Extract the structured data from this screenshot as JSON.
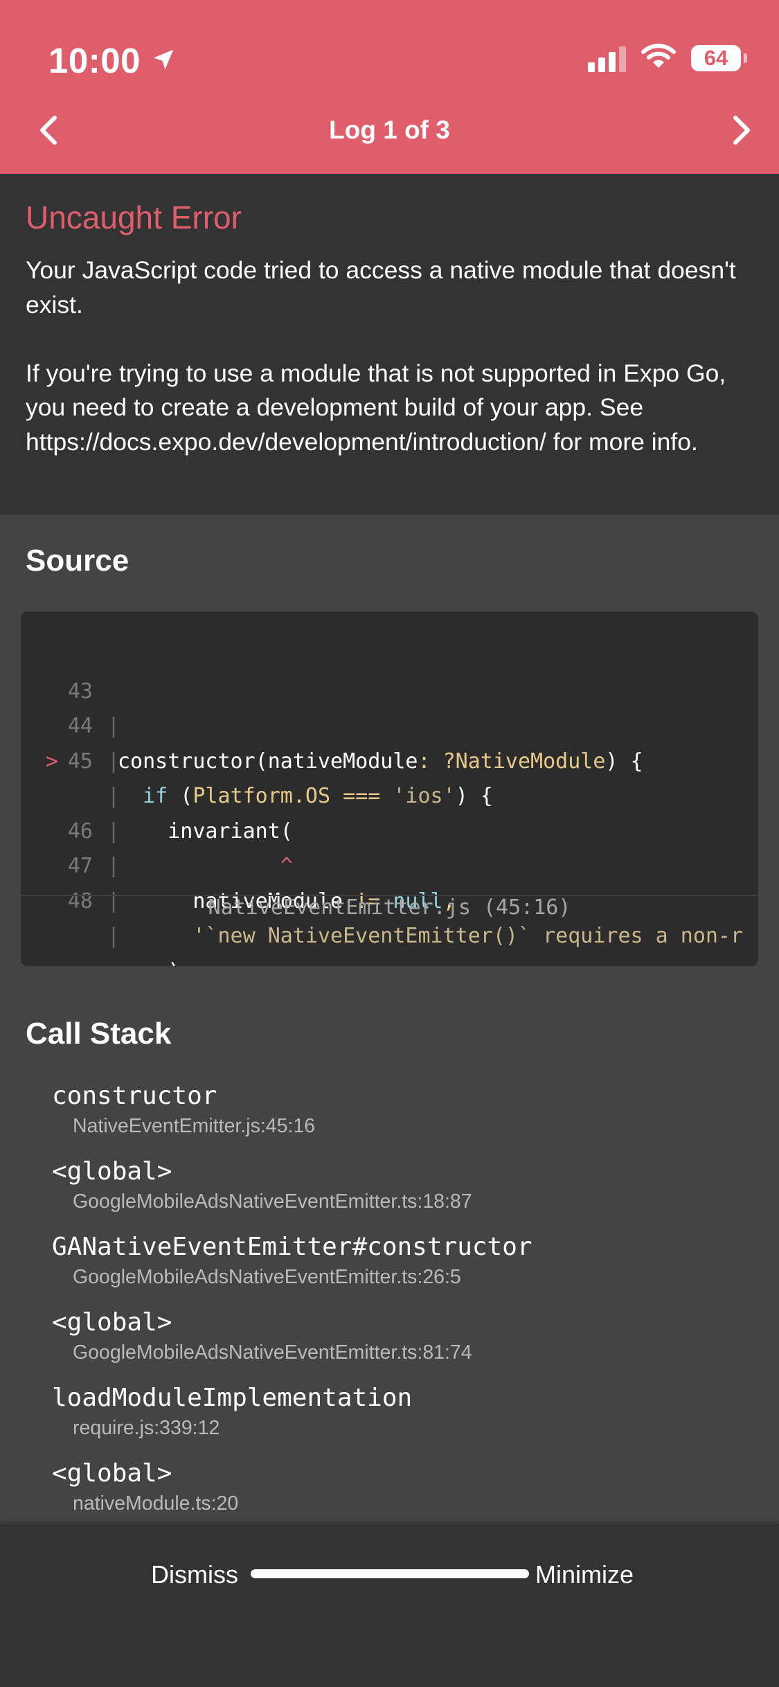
{
  "status_bar": {
    "time": "10:00",
    "battery": "64"
  },
  "nav": {
    "title": "Log 1 of 3"
  },
  "error": {
    "title": "Uncaught Error",
    "message": "Your JavaScript code tried to access a native module that doesn't exist.\n\nIf you're trying to use a module that is not supported in Expo Go, you need to create a development build of your app. See https://docs.expo.dev/development/introduction/ for more info."
  },
  "source": {
    "heading": "Source",
    "lines": [
      {
        "num": "43",
        "mark": ""
      },
      {
        "num": "44",
        "mark": ""
      },
      {
        "num": "45",
        "mark": ">"
      },
      {
        "num": "",
        "mark": ""
      },
      {
        "num": "46",
        "mark": ""
      },
      {
        "num": "47",
        "mark": ""
      },
      {
        "num": "48",
        "mark": ""
      }
    ],
    "file": "NativeEventEmitter.js (45:16)"
  },
  "call_stack": {
    "heading": "Call Stack",
    "frames": [
      {
        "name": "constructor",
        "file": "NativeEventEmitter.js:45:16"
      },
      {
        "name": "<global>",
        "file": "GoogleMobileAdsNativeEventEmitter.ts:18:87"
      },
      {
        "name": "GANativeEventEmitter#constructor",
        "file": "GoogleMobileAdsNativeEventEmitter.ts:26:5"
      },
      {
        "name": "<global>",
        "file": "GoogleMobileAdsNativeEventEmitter.ts:81:74"
      },
      {
        "name": "loadModuleImplementation",
        "file": "require.js:339:12"
      },
      {
        "name": "<global>",
        "file": "nativeModule.ts:20"
      }
    ]
  },
  "actions": {
    "dismiss": "Dismiss",
    "minimize": "Minimize"
  },
  "colors": {
    "header": "#e05e6c",
    "panel": "#333333",
    "background": "#444444"
  }
}
